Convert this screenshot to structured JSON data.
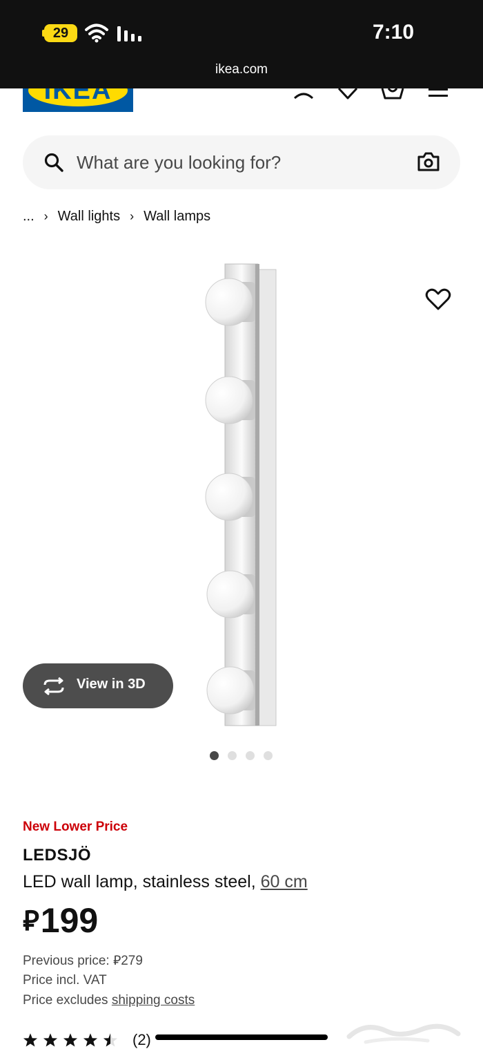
{
  "status_bar": {
    "battery_level": "29",
    "time": "7:10",
    "url": "ikea.com"
  },
  "header": {
    "logo_text": "IKEA",
    "icons": [
      "account-icon",
      "heart-icon",
      "cart-icon",
      "menu-icon"
    ]
  },
  "search": {
    "placeholder": "What are you looking for?"
  },
  "breadcrumb": {
    "ellipsis": "...",
    "items": [
      "Wall lights",
      "Wall lamps"
    ]
  },
  "gallery": {
    "view_3d_label": "View in 3D",
    "image_count": 4,
    "active_index": 0
  },
  "product": {
    "badge": "New Lower Price",
    "name": "LEDSJÖ",
    "description": "LED wall lamp, stainless steel,",
    "size_link": "60 cm",
    "currency_symbol": "⃁",
    "price": "199",
    "previous_price_label": "Previous price:",
    "previous_price": "⃁279",
    "vat_note": "Price incl. VAT",
    "shipping_prefix": "Price excludes",
    "shipping_link": "shipping costs",
    "rating": 4.5,
    "review_count": "(2)"
  },
  "colors": {
    "ikea_blue": "#0058a3",
    "ikea_yellow": "#ffdb00",
    "badge_red": "#cc0008",
    "button_dark": "#4d4d4d"
  }
}
